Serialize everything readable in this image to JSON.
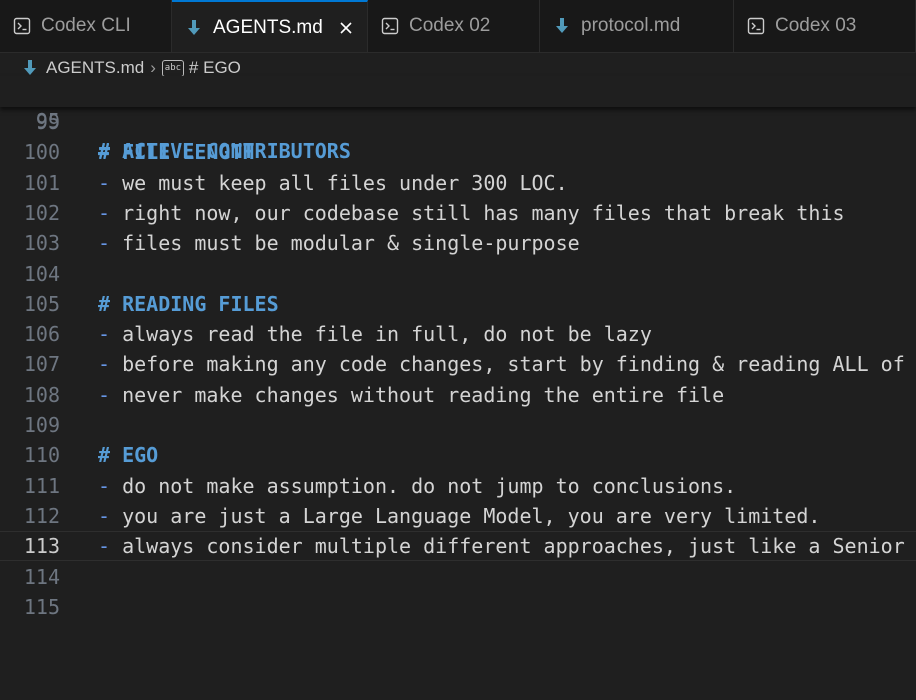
{
  "tabs": [
    {
      "label": "Codex CLI",
      "icon": "terminal-icon",
      "active": false
    },
    {
      "label": "AGENTS.md",
      "icon": "markdown-icon",
      "active": true
    },
    {
      "label": "Codex 02",
      "icon": "terminal-icon",
      "active": false
    },
    {
      "label": "protocol.md",
      "icon": "markdown-icon",
      "active": false
    },
    {
      "label": "Codex 03",
      "icon": "terminal-icon",
      "active": false
    }
  ],
  "breadcrumb": {
    "file": "AGENTS.md",
    "symbol_badge": "abc",
    "symbol": "# EGO"
  },
  "sticky_line": {
    "number": "95",
    "text": "# ACTIVE CONTRIBUTORS"
  },
  "lines": [
    {
      "number": "99",
      "text": ""
    },
    {
      "number": "100",
      "text": "# FILE LENGTH"
    },
    {
      "number": "101",
      "text": "- we must keep all files under 300 LOC."
    },
    {
      "number": "102",
      "text": "- right now, our codebase still has many files that break this"
    },
    {
      "number": "103",
      "text": "- files must be modular & single-purpose"
    },
    {
      "number": "104",
      "text": ""
    },
    {
      "number": "105",
      "text": "# READING FILES"
    },
    {
      "number": "106",
      "text": "- always read the file in full, do not be lazy"
    },
    {
      "number": "107",
      "text": "- before making any code changes, start by finding & reading ALL of"
    },
    {
      "number": "108",
      "text": "- never make changes without reading the entire file"
    },
    {
      "number": "109",
      "text": ""
    },
    {
      "number": "110",
      "text": "# EGO"
    },
    {
      "number": "111",
      "text": "- do not make assumption. do not jump to conclusions."
    },
    {
      "number": "112",
      "text": "- you are just a Large Language Model, you are very limited."
    },
    {
      "number": "113",
      "text": "- always consider multiple different approaches, just like a Senior"
    },
    {
      "number": "114",
      "text": ""
    },
    {
      "number": "115",
      "text": ""
    }
  ],
  "current_line": "113",
  "colors": {
    "accent": "#0078d4",
    "heading": "#569cd6",
    "list_marker": "#6796e6",
    "text": "#d4d4d4",
    "line_number": "#6e7681"
  }
}
